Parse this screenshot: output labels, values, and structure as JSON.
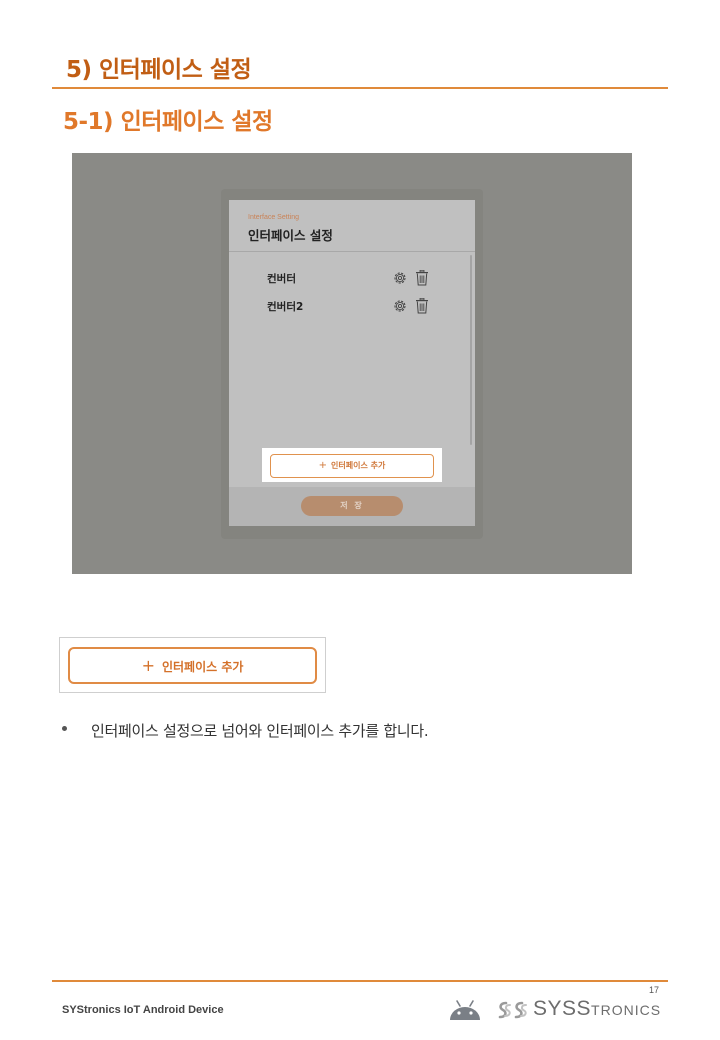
{
  "section": {
    "title": "5) 인터페이스 설정"
  },
  "subsection": {
    "title": "5-1) 인터페이스 설정"
  },
  "dialog": {
    "subtitle": "Interface Setting",
    "title": "인터페이스 설정",
    "items": [
      {
        "label": "컨버터"
      },
      {
        "label": "컨버터2"
      }
    ],
    "add_button": {
      "plus": "+",
      "label": "인터페이스 추가"
    },
    "save_button": {
      "label": "저 장"
    }
  },
  "zoom": {
    "plus": "+",
    "label": "인터페이스 추가"
  },
  "bullets": [
    "인터페이스 설정으로 넘어와 인터페이스 추가를 합니다."
  ],
  "footer": {
    "page_number": "17",
    "doc_title": "SYStronics IoT Android Device",
    "brand": {
      "big1": "S",
      "mid": "YS",
      "big2": "S",
      "rest": "TRONICS"
    }
  },
  "colors": {
    "heading": "#c15e14",
    "subheading": "#e0782a",
    "accent_rule": "#e08a3a",
    "button_border": "#e08b45"
  }
}
